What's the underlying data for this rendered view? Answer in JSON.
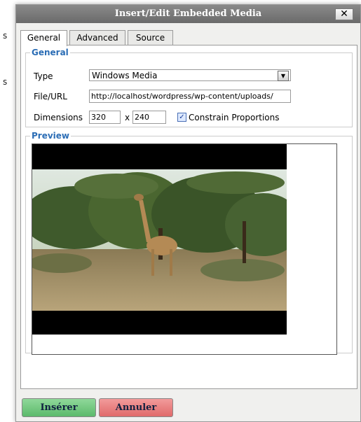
{
  "background": {
    "fragment_1": "s",
    "fragment_2": "s"
  },
  "dialog": {
    "title": "Insert/Edit Embedded Media",
    "close_symbol": "✕",
    "tabs": [
      {
        "label": "General",
        "active": true
      },
      {
        "label": "Advanced",
        "active": false
      },
      {
        "label": "Source",
        "active": false
      }
    ],
    "general": {
      "legend": "General",
      "type_label": "Type",
      "type_value": "Windows Media",
      "url_label": "File/URL",
      "url_value": "http://localhost/wordpress/wp-content/uploads/",
      "dimensions_label": "Dimensions",
      "width": "320",
      "times": "x",
      "height": "240",
      "constrain_checked": true,
      "constrain_label": "Constrain Proportions"
    },
    "preview": {
      "legend": "Preview"
    },
    "buttons": {
      "insert": "Insérer",
      "cancel": "Annuler"
    }
  },
  "colors": {
    "legend": "#2b6db5",
    "insert_button": "#6cc47a",
    "cancel_button": "#e87a7a",
    "title_bar": "#7a7a7a"
  }
}
